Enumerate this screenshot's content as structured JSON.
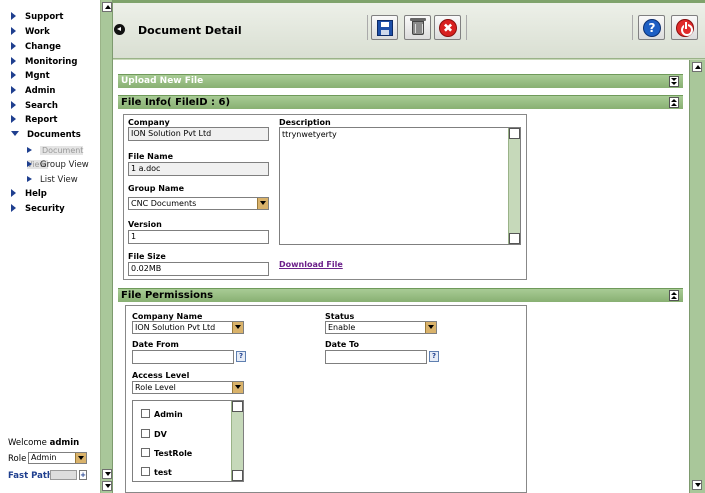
{
  "sidebar": {
    "items": [
      {
        "label": "Support"
      },
      {
        "label": "Work"
      },
      {
        "label": "Change"
      },
      {
        "label": "Monitoring"
      },
      {
        "label": "Mgnt"
      },
      {
        "label": "Admin"
      },
      {
        "label": "Search"
      },
      {
        "label": "Report"
      },
      {
        "label": "Documents"
      },
      {
        "label": "Help"
      },
      {
        "label": "Security"
      }
    ],
    "sub_items": [
      {
        "label": "Document View"
      },
      {
        "label": "Group View"
      },
      {
        "label": "List View"
      }
    ],
    "welcome_prefix": "Welcome",
    "welcome_user": "admin",
    "role_label": "Role",
    "role_value": "Admin",
    "fast_path_label": "Fast Path",
    "fast_path_go": "+"
  },
  "header": {
    "title": "Document Detail",
    "cancel_glyph": "✖",
    "help_glyph": "?"
  },
  "upload_bar": {
    "title": "Upload New File"
  },
  "file_info": {
    "title": "File Info( FileID : 6)",
    "company_label": "Company",
    "company_value": "ION Solution Pvt Ltd",
    "filename_label": "File Name",
    "filename_value": "1 a.doc",
    "group_label": "Group Name",
    "group_value": "CNC Documents",
    "version_label": "Version",
    "version_value": "1",
    "filesize_label": "File Size",
    "filesize_value": "0.02MB",
    "description_label": "Description",
    "description_value": "ttrynwetyerty",
    "download_label": "Download File"
  },
  "permissions": {
    "title": "File Permissions",
    "company_label": "Company Name",
    "company_value": "ION Solution Pvt Ltd",
    "status_label": "Status",
    "status_value": "Enable",
    "date_from_label": "Date From",
    "date_from_value": "",
    "date_to_label": "Date To",
    "date_to_value": "",
    "cal_glyph": "?",
    "access_label": "Access Level",
    "access_value": "Role Level",
    "roles": [
      {
        "label": "Admin"
      },
      {
        "label": "DV"
      },
      {
        "label": "TestRole"
      },
      {
        "label": "test"
      }
    ]
  }
}
